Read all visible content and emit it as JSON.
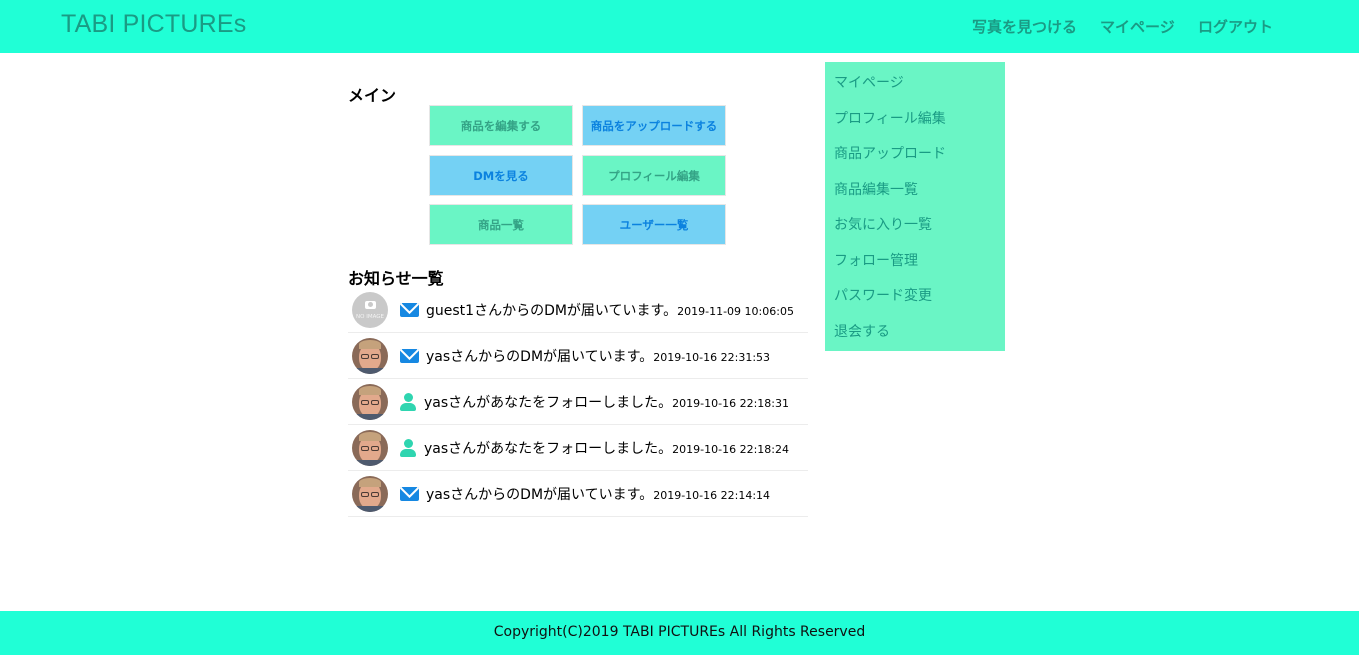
{
  "header": {
    "logo": "TABI PICTUREs",
    "nav": [
      "写真を見つける",
      "マイページ",
      "ログアウト"
    ]
  },
  "main": {
    "title": "メイン",
    "buttons": [
      {
        "label": "商品を編集する",
        "color": "#6af5c5"
      },
      {
        "label": "商品をアップロードする",
        "color": "#74d1f4"
      },
      {
        "label": "DMを見る",
        "color": "#74d1f4"
      },
      {
        "label": "プロフィール編集",
        "color": "#6af5c5"
      },
      {
        "label": "商品一覧",
        "color": "#6af5c5"
      },
      {
        "label": "ユーザー一覧",
        "color": "#74d1f4"
      }
    ]
  },
  "notices": {
    "title": "お知らせ一覧",
    "avatar_placeholder": "NO IMAGE",
    "items": [
      {
        "icon": "mail-icon",
        "avatar": "no-image",
        "text": "guest1さんからのDMが届いています。",
        "time": "2019-11-09 10:06:05"
      },
      {
        "icon": "mail-icon",
        "avatar": "photo",
        "text": "yasさんからのDMが届いています。",
        "time": "2019-10-16 22:31:53"
      },
      {
        "icon": "user-icon",
        "avatar": "photo",
        "text": "yasさんがあなたをフォローしました。",
        "time": "2019-10-16 22:18:31"
      },
      {
        "icon": "user-icon",
        "avatar": "photo",
        "text": "yasさんがあなたをフォローしました。",
        "time": "2019-10-16 22:18:24"
      },
      {
        "icon": "mail-icon",
        "avatar": "photo",
        "text": "yasさんからのDMが届いています。",
        "time": "2019-10-16 22:14:14"
      }
    ]
  },
  "sidebar": {
    "items": [
      "マイページ",
      "プロフィール編集",
      "商品アップロード",
      "商品編集一覧",
      "お気に入り一覧",
      "フォロー管理",
      "パスワード変更",
      "退会する"
    ]
  },
  "footer": {
    "copyright": "Copyright(C)2019 TABI PICTUREs All Rights Reserved"
  },
  "colors": {
    "header_bg": "#20ffd6",
    "accent_text": "#1a9b84",
    "green_button": "#6af5c5",
    "blue_button": "#74d1f4",
    "mail_icon": "#1688e2",
    "user_icon": "#2fd5b0"
  }
}
